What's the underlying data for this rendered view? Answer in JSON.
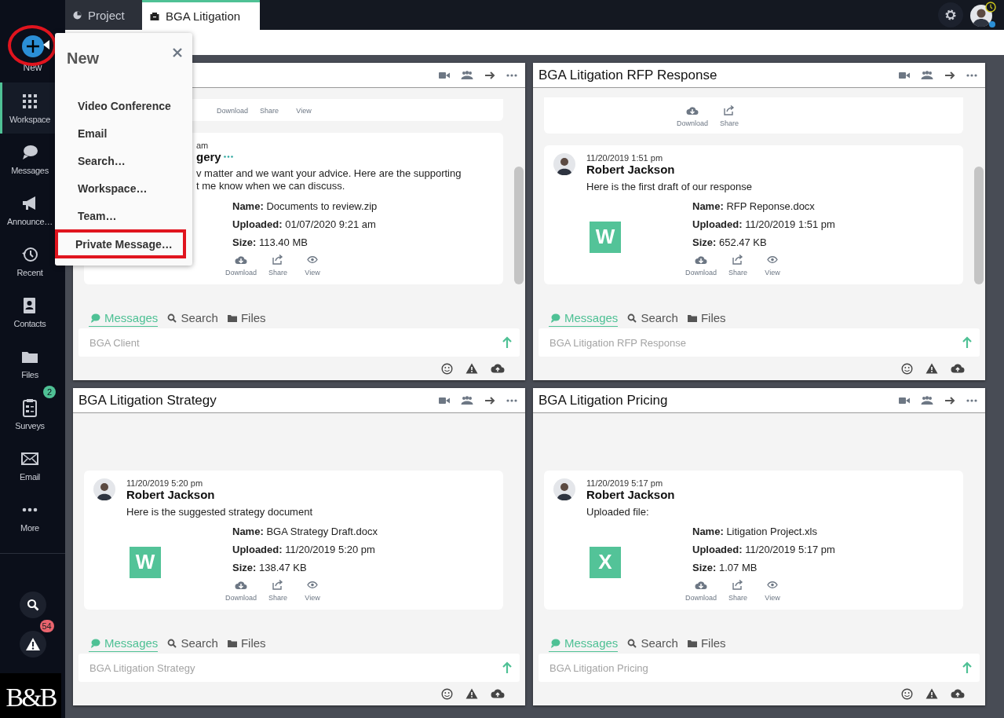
{
  "top_tabs": [
    {
      "label": "Project",
      "selected": false
    },
    {
      "label": "BGA Litigation",
      "selected": true
    }
  ],
  "sidebar": {
    "new_label": "New",
    "new_annotated": true,
    "items": [
      {
        "label": "Workspace",
        "selected": true
      },
      {
        "label": "Messages",
        "selected": false
      },
      {
        "label": "Announce…",
        "selected": false
      },
      {
        "label": "Recent",
        "selected": false
      },
      {
        "label": "Contacts",
        "selected": false
      },
      {
        "label": "Files",
        "selected": false
      },
      {
        "label": "Surveys",
        "selected": false,
        "badge": "2"
      },
      {
        "label": "Email",
        "selected": false
      },
      {
        "label": "More",
        "selected": false
      }
    ],
    "alert_badge": "54",
    "logo": "B&B"
  },
  "new_menu": {
    "title": "New",
    "items": [
      {
        "label": "Video Conference",
        "highlighted": false
      },
      {
        "label": "Email",
        "highlighted": false
      },
      {
        "label": "Search…",
        "highlighted": false
      },
      {
        "label": "Workspace…",
        "highlighted": false
      },
      {
        "label": "Team…",
        "highlighted": false
      },
      {
        "label": "Private Message…",
        "highlighted": true
      }
    ]
  },
  "panels": [
    {
      "scrollbar": true,
      "messages": [
        {
          "kind": "actions",
          "icons_visible": false,
          "actions": [
            "Download",
            "Share",
            "View"
          ]
        },
        {
          "kind": "partial",
          "time": "am",
          "author": "gery",
          "text_lines": [
            "v matter and we want your advice. Here are the supporting",
            "t me know when we can discuss."
          ],
          "fields": [
            {
              "label": "Name:",
              "value": "Documents to review.zip"
            },
            {
              "label": "Uploaded:",
              "value": "01/07/2020 9:21 am"
            },
            {
              "label": "Size:",
              "value": "113.40 MB"
            }
          ],
          "actions": [
            "Download",
            "Share",
            "View"
          ]
        }
      ],
      "tabs": [
        {
          "label": "Messages",
          "selected": true
        },
        {
          "label": "Search",
          "selected": false
        },
        {
          "label": "Files",
          "selected": false
        }
      ],
      "placeholder": "BGA Client"
    },
    {
      "title": "BGA Litigation RFP Response",
      "scrollbar": true,
      "messages": [
        {
          "kind": "actions",
          "icons_visible": true,
          "actions": [
            "Download",
            "Share"
          ]
        },
        {
          "kind": "post",
          "time": "11/20/2019 1:51 pm",
          "author": "Robert Jackson",
          "text": "Here is the first draft of our response",
          "file_badge": "W",
          "fields": [
            {
              "label": "Name:",
              "value": "RFP Reponse.docx"
            },
            {
              "label": "Uploaded:",
              "value": "11/20/2019 1:51 pm"
            },
            {
              "label": "Size:",
              "value": "652.47 KB"
            }
          ],
          "actions": [
            "Download",
            "Share",
            "View"
          ]
        }
      ],
      "tabs": [
        {
          "label": "Messages",
          "selected": true
        },
        {
          "label": "Search",
          "selected": false
        },
        {
          "label": "Files",
          "selected": false
        }
      ],
      "placeholder": "BGA Litigation RFP Response"
    },
    {
      "title": "BGA Litigation Strategy",
      "scrollbar": false,
      "messages": [
        {
          "kind": "post",
          "time": "11/20/2019 5:20 pm",
          "author": "Robert Jackson",
          "text": "Here is the suggested strategy document",
          "file_badge": "W",
          "fields": [
            {
              "label": "Name:",
              "value": "BGA Strategy Draft.docx"
            },
            {
              "label": "Uploaded:",
              "value": "11/20/2019 5:20 pm"
            },
            {
              "label": "Size:",
              "value": "138.47 KB"
            }
          ],
          "actions": [
            "Download",
            "Share",
            "View"
          ]
        }
      ],
      "tabs": [
        {
          "label": "Messages",
          "selected": true
        },
        {
          "label": "Search",
          "selected": false
        },
        {
          "label": "Files",
          "selected": false
        }
      ],
      "placeholder": "BGA Litigation Strategy"
    },
    {
      "title": "BGA Litigation Pricing",
      "scrollbar": false,
      "messages": [
        {
          "kind": "post",
          "time": "11/20/2019 5:17 pm",
          "author": "Robert Jackson",
          "text": "Uploaded file:",
          "file_badge": "X",
          "fields": [
            {
              "label": "Name:",
              "value": "Litigation Project.xls"
            },
            {
              "label": "Uploaded:",
              "value": "11/20/2019 5:17 pm"
            },
            {
              "label": "Size:",
              "value": "1.07 MB"
            }
          ],
          "actions": [
            "Download",
            "Share",
            "View"
          ]
        }
      ],
      "tabs": [
        {
          "label": "Messages",
          "selected": true
        },
        {
          "label": "Search",
          "selected": false
        },
        {
          "label": "Files",
          "selected": false
        }
      ],
      "placeholder": "BGA Litigation Pricing"
    }
  ]
}
